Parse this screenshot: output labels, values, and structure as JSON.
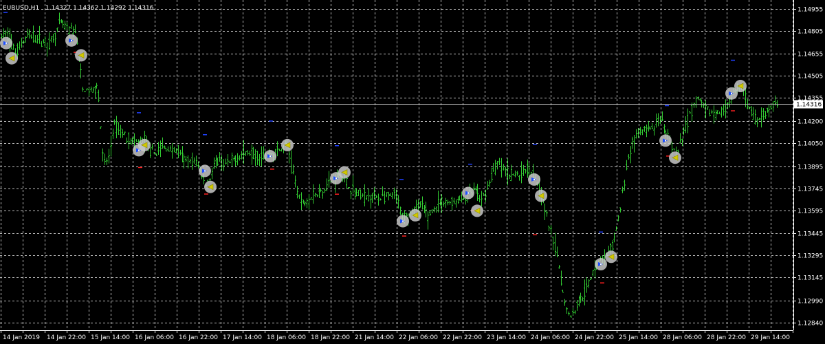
{
  "window": {
    "symbol_label": "EURUSD,H1",
    "ohlc_label": "1.14327 1.14362 1.14292 1.14316"
  },
  "colors": {
    "background": "#000000",
    "grid": "#c0c0c0",
    "bars": "#32cd32",
    "axis_text": "#ffffff",
    "current_price_box": "#ffffff",
    "marker_circle": "#c8c8c8",
    "marker_buy_arrow": "#1e50ff",
    "marker_close_arrow": "#d2c800",
    "tick_blue": "#2040ff",
    "tick_red": "#ff2020"
  },
  "chart_data": {
    "type": "bar",
    "symbol": "EURUSD",
    "timeframe": "H1",
    "ylim": [
      1.1284,
      1.1495
    ],
    "grid": true,
    "current_price": 1.14316,
    "y_ticks": [
      "1.14955",
      "1.14805",
      "1.14655",
      "1.14505",
      "1.14355",
      "1.14200",
      "1.14050",
      "1.13895",
      "1.13745",
      "1.13595",
      "1.13445",
      "1.13295",
      "1.13145",
      "1.12990",
      "1.12840"
    ],
    "x_ticks": [
      "14 Jan 2019",
      "14 Jan 22:00",
      "15 Jan 14:00",
      "16 Jan 06:00",
      "16 Jan 22:00",
      "17 Jan 14:00",
      "18 Jan 06:00",
      "18 Jan 22:00",
      "21 Jan 14:00",
      "22 Jan 06:00",
      "22 Jan 22:00",
      "23 Jan 14:00",
      "24 Jan 06:00",
      "24 Jan 22:00",
      "25 Jan 14:00",
      "28 Jan 06:00",
      "28 Jan 22:00",
      "29 Jan 14:00"
    ],
    "price_path": [
      [
        0,
        1.1477
      ],
      [
        12,
        1.1478
      ],
      [
        22,
        1.1466
      ],
      [
        40,
        1.1478
      ],
      [
        60,
        1.1474
      ],
      [
        72,
        1.1472
      ],
      [
        88,
        1.1486
      ],
      [
        98,
        1.1482
      ],
      [
        110,
        1.148
      ],
      [
        120,
        1.1441
      ],
      [
        135,
        1.144
      ],
      [
        142,
        1.1446
      ],
      [
        150,
        1.139
      ],
      [
        158,
        1.1395
      ],
      [
        165,
        1.1417
      ],
      [
        180,
        1.1411
      ],
      [
        195,
        1.1405
      ],
      [
        210,
        1.1407
      ],
      [
        222,
        1.1398
      ],
      [
        238,
        1.1402
      ],
      [
        255,
        1.14
      ],
      [
        270,
        1.1393
      ],
      [
        285,
        1.1392
      ],
      [
        300,
        1.1377
      ],
      [
        315,
        1.1393
      ],
      [
        330,
        1.139
      ],
      [
        345,
        1.1396
      ],
      [
        360,
        1.1399
      ],
      [
        375,
        1.1397
      ],
      [
        390,
        1.1397
      ],
      [
        405,
        1.14
      ],
      [
        418,
        1.1404
      ],
      [
        428,
        1.138
      ],
      [
        438,
        1.1364
      ],
      [
        450,
        1.1368
      ],
      [
        465,
        1.1372
      ],
      [
        480,
        1.1379
      ],
      [
        495,
        1.1385
      ],
      [
        505,
        1.1377
      ],
      [
        515,
        1.1372
      ],
      [
        530,
        1.1369
      ],
      [
        545,
        1.1369
      ],
      [
        560,
        1.1368
      ],
      [
        575,
        1.137
      ],
      [
        585,
        1.1355
      ],
      [
        600,
        1.1359
      ],
      [
        612,
        1.1363
      ],
      [
        622,
        1.1356
      ],
      [
        635,
        1.1363
      ],
      [
        650,
        1.1365
      ],
      [
        665,
        1.1366
      ],
      [
        680,
        1.1369
      ],
      [
        690,
        1.1374
      ],
      [
        700,
        1.1365
      ],
      [
        712,
        1.138
      ],
      [
        724,
        1.1392
      ],
      [
        740,
        1.1384
      ],
      [
        755,
        1.1384
      ],
      [
        770,
        1.1389
      ],
      [
        780,
        1.138
      ],
      [
        790,
        1.1365
      ],
      [
        800,
        1.1346
      ],
      [
        810,
        1.133
      ],
      [
        820,
        1.13
      ],
      [
        830,
        1.1288
      ],
      [
        845,
        1.1302
      ],
      [
        855,
        1.1308
      ],
      [
        865,
        1.1323
      ],
      [
        880,
        1.1328
      ],
      [
        892,
        1.1336
      ],
      [
        902,
        1.1361
      ],
      [
        910,
        1.1387
      ],
      [
        918,
        1.1404
      ],
      [
        930,
        1.1413
      ],
      [
        945,
        1.1414
      ],
      [
        960,
        1.142
      ],
      [
        975,
        1.1405
      ],
      [
        985,
        1.1397
      ],
      [
        995,
        1.1414
      ],
      [
        1005,
        1.1426
      ],
      [
        1015,
        1.1436
      ],
      [
        1025,
        1.1427
      ],
      [
        1040,
        1.1425
      ],
      [
        1050,
        1.1426
      ],
      [
        1060,
        1.1434
      ],
      [
        1070,
        1.144
      ],
      [
        1080,
        1.1442
      ],
      [
        1090,
        1.1427
      ],
      [
        1100,
        1.142
      ],
      [
        1110,
        1.1424
      ],
      [
        1120,
        1.1429
      ],
      [
        1130,
        1.1431
      ]
    ],
    "trade_markers": [
      {
        "kind": "buy",
        "price": 1.14724
      },
      {
        "kind": "close",
        "price": 1.14622
      },
      {
        "kind": "buy",
        "price": 1.14742
      },
      {
        "kind": "close",
        "price": 1.14642
      },
      {
        "kind": "buy",
        "price": 1.14002
      },
      {
        "kind": "close",
        "price": 1.14037
      },
      {
        "kind": "buy",
        "price": 1.13863
      },
      {
        "kind": "close",
        "price": 1.13755
      },
      {
        "kind": "buy",
        "price": 1.13962
      },
      {
        "kind": "close",
        "price": 1.14037
      },
      {
        "kind": "buy",
        "price": 1.13813
      },
      {
        "kind": "close",
        "price": 1.13853
      },
      {
        "kind": "buy",
        "price": 1.13524
      },
      {
        "kind": "close",
        "price": 1.13564
      },
      {
        "kind": "buy",
        "price": 1.13714
      },
      {
        "kind": "close",
        "price": 1.13594
      },
      {
        "kind": "buy",
        "price": 1.13805
      },
      {
        "kind": "close",
        "price": 1.13695
      },
      {
        "kind": "buy",
        "price": 1.13234
      },
      {
        "kind": "close",
        "price": 1.13284
      },
      {
        "kind": "buy",
        "price": 1.14067
      },
      {
        "kind": "close",
        "price": 1.13952
      },
      {
        "kind": "buy",
        "price": 1.14385
      },
      {
        "kind": "close",
        "price": 1.14435
      }
    ],
    "level_ticks": [
      {
        "color": "blue",
        "price": 1.14931
      },
      {
        "color": "red",
        "price": 1.14662
      },
      {
        "color": "blue",
        "price": 1.14255
      },
      {
        "color": "red",
        "price": 1.13886
      },
      {
        "color": "blue",
        "price": 1.14107
      },
      {
        "color": "red",
        "price": 1.13707
      },
      {
        "color": "blue",
        "price": 1.14199
      },
      {
        "color": "red",
        "price": 1.13875
      },
      {
        "color": "blue",
        "price": 1.14033
      },
      {
        "color": "red",
        "price": 1.13706
      },
      {
        "color": "blue",
        "price": 1.13805
      },
      {
        "color": "red",
        "price": 1.13424
      },
      {
        "color": "blue",
        "price": 1.13908
      },
      {
        "color": "red",
        "price": 1.13595
      },
      {
        "color": "blue",
        "price": 1.14042
      },
      {
        "color": "red",
        "price": 1.13433
      },
      {
        "color": "blue",
        "price": 1.13451
      },
      {
        "color": "red",
        "price": 1.13108
      },
      {
        "color": "blue",
        "price": 1.14303
      },
      {
        "color": "red",
        "price": 1.13963
      },
      {
        "color": "blue",
        "price": 1.14609
      },
      {
        "color": "red",
        "price": 1.14268
      }
    ]
  }
}
